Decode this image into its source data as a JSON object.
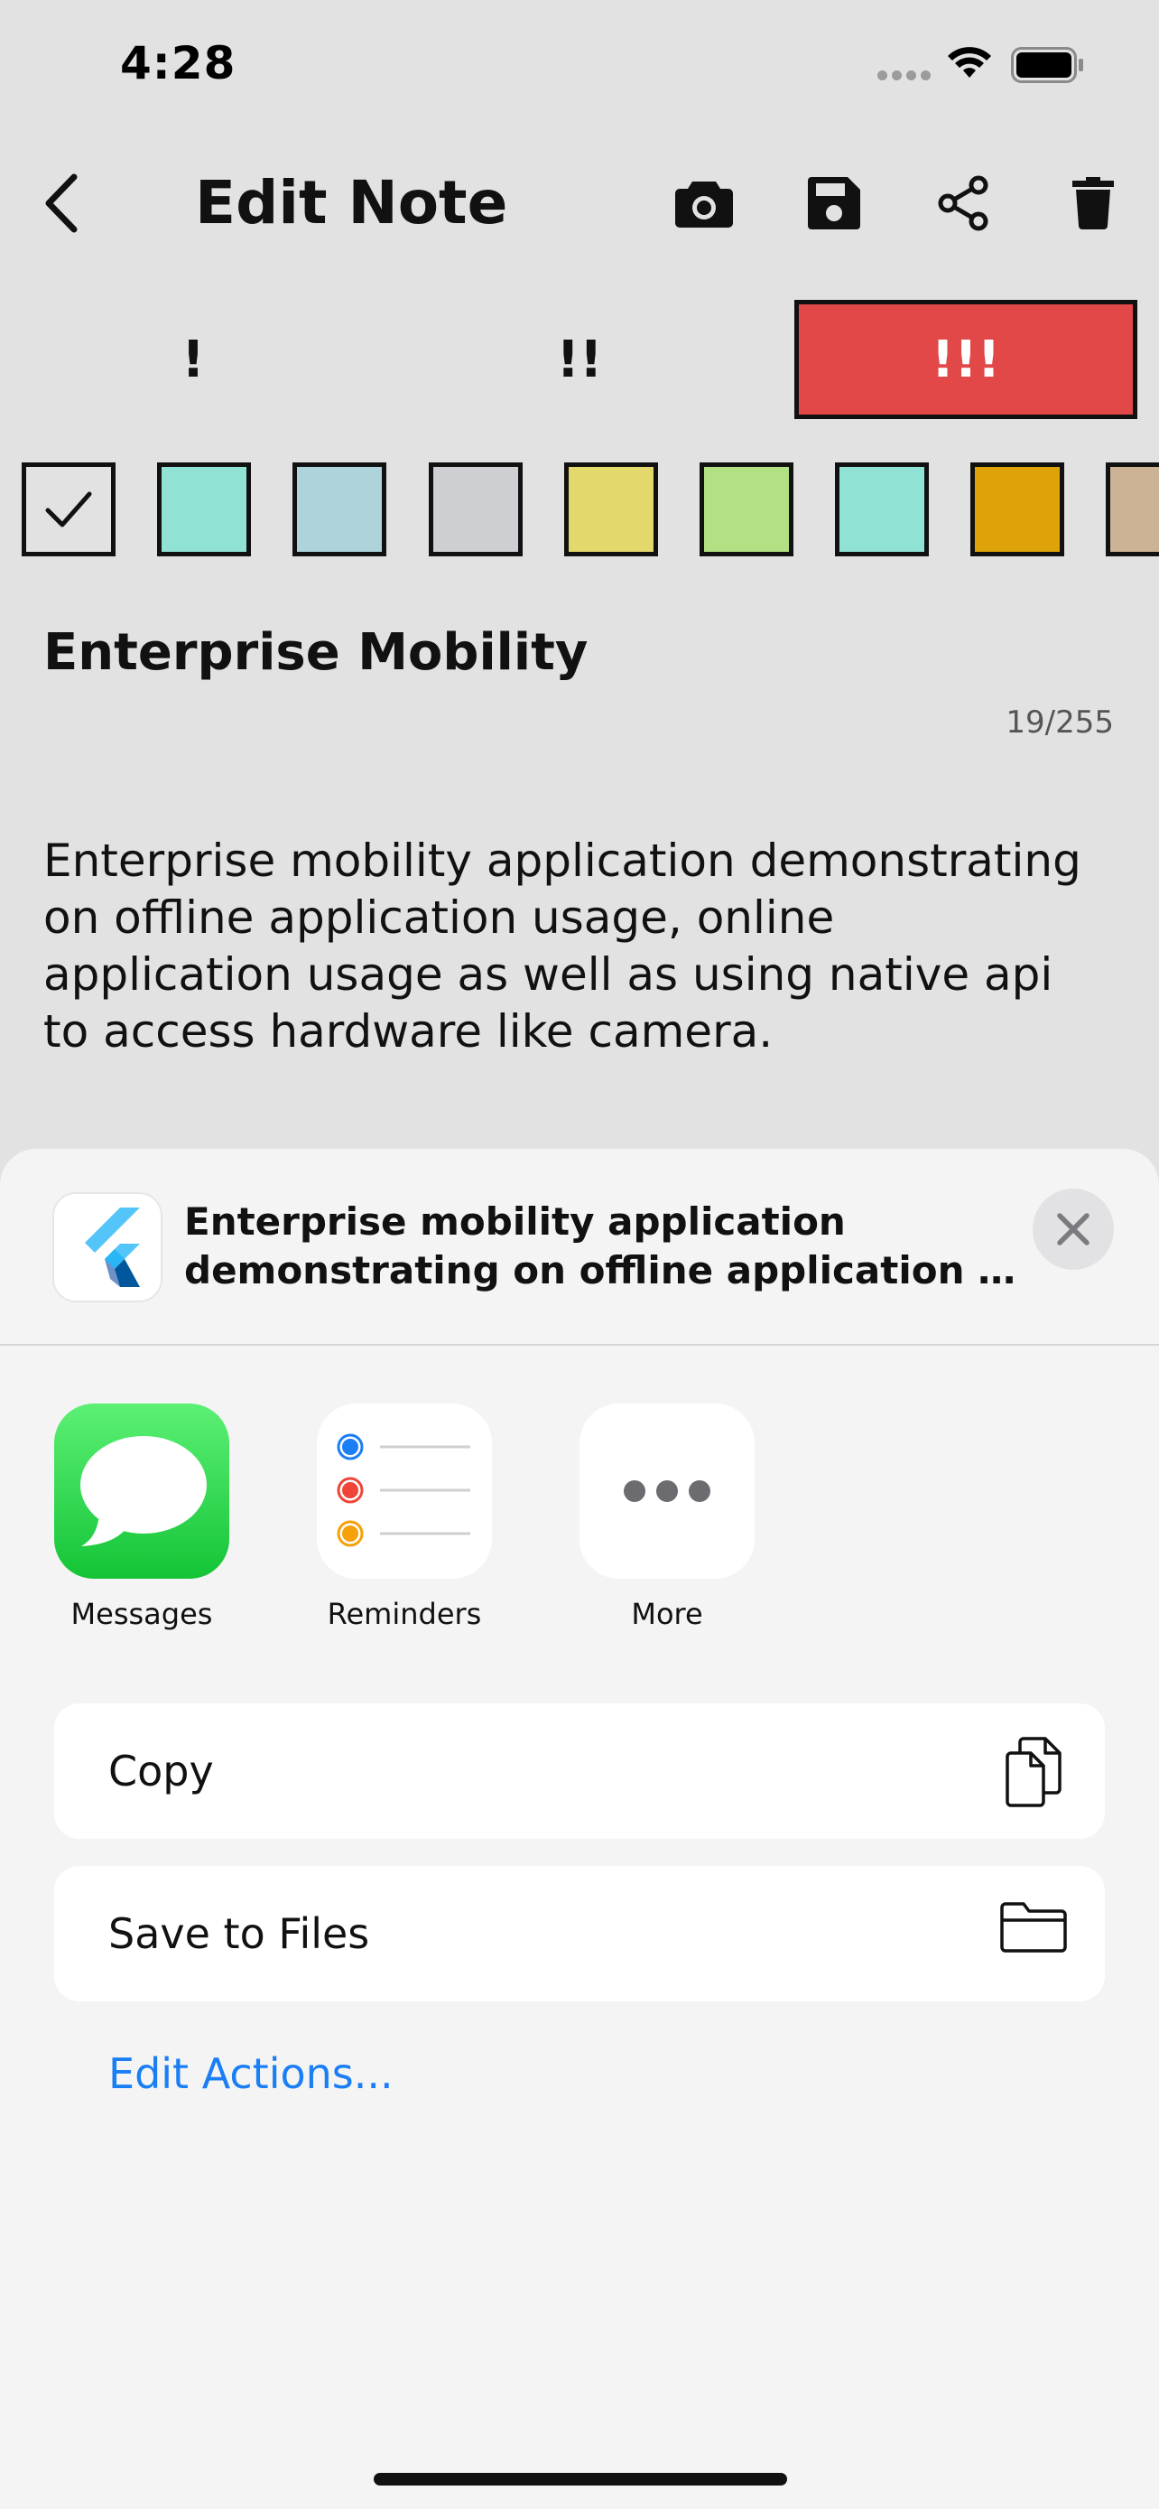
{
  "status_bar": {
    "time": "4:28"
  },
  "app_bar": {
    "title": "Edit Note",
    "actions": [
      "camera-icon",
      "save-icon",
      "share-icon",
      "delete-icon"
    ]
  },
  "priority": {
    "options": [
      "!",
      "!!",
      "!!!"
    ],
    "selected": "!!!",
    "selected_color": "#e24848"
  },
  "colors": {
    "swatches": [
      "#ffffff",
      "#90e3d4",
      "#aed3da",
      "#cdcfd2",
      "#e2d86c",
      "#b3e083",
      "#90e3d4",
      "#dea309",
      "#ccb396"
    ],
    "selected_index": 0
  },
  "note": {
    "title": "Enterprise Mobility",
    "char_count": "19/255",
    "body": "Enterprise mobility application demonstrating\non offline application usage, online\napplication usage as well as using native api\nto access hardware like camera."
  },
  "share_sheet": {
    "preview_line1": "Enterprise mobility application",
    "preview_line2": "demonstrating on offline application usa...",
    "apps": [
      {
        "label": "Messages",
        "icon": "messages-icon"
      },
      {
        "label": "Reminders",
        "icon": "reminders-icon"
      },
      {
        "label": "More",
        "icon": "more-icon"
      }
    ],
    "actions": [
      {
        "label": "Copy",
        "icon": "copy-icon"
      },
      {
        "label": "Save to Files",
        "icon": "folder-icon"
      }
    ],
    "edit_actions": "Edit Actions..."
  }
}
